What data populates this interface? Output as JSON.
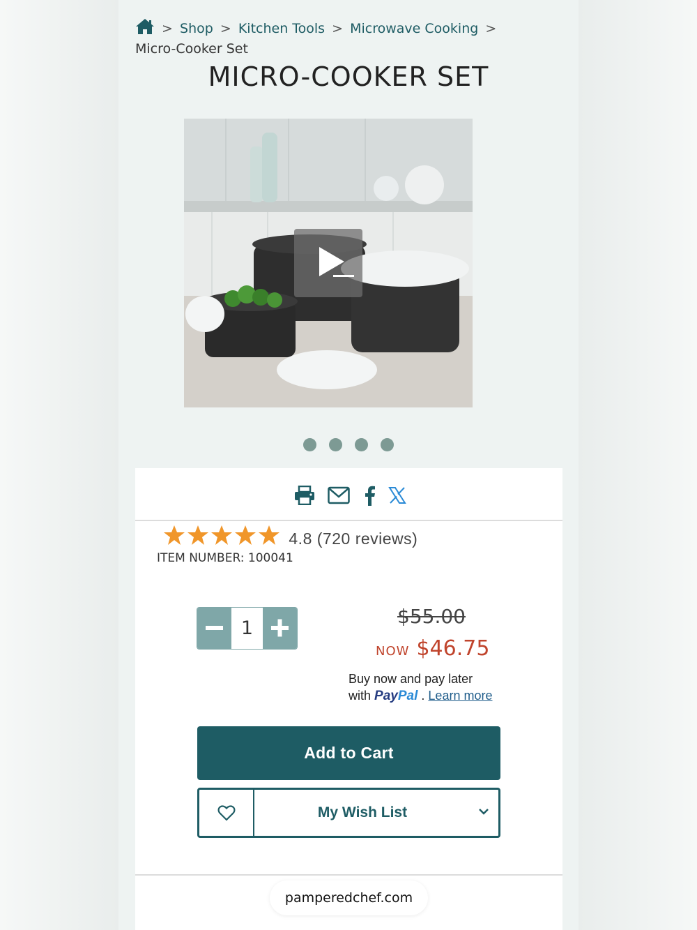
{
  "breadcrumb": {
    "sep": ">",
    "items": [
      "Shop",
      "Kitchen Tools",
      "Microwave Cooking"
    ],
    "current": "Micro-Cooker Set"
  },
  "product": {
    "title": "MICRO-COOKER SET",
    "image_alt": "Micro-Cooker Set product video",
    "carousel_dots": 4,
    "rating": "4.8",
    "rating_count": "(720 reviews)",
    "stars": 5,
    "item_number_label": "ITEM NUMBER:",
    "item_number": "100041",
    "quantity": "1",
    "old_price": "$55.00",
    "now_label": "NOW",
    "now_price": "$46.75",
    "paylater_line1": "Buy now and pay later",
    "paylater_with": "with",
    "paypal_pay": "Pay",
    "paypal_pal": "Pal",
    "paylater_dot": ".",
    "learn_more": "Learn more"
  },
  "actions": {
    "add_to_cart": "Add to Cart",
    "wish_list": "My Wish List"
  },
  "share": [
    "print-icon",
    "email-icon",
    "facebook-icon",
    "x-icon"
  ],
  "browser": {
    "url": "pamperedchef.com"
  },
  "colors": {
    "brand": "#1e5c64",
    "sale": "#c0442c",
    "star": "#f0962a",
    "stepper": "#7fa7a8"
  }
}
